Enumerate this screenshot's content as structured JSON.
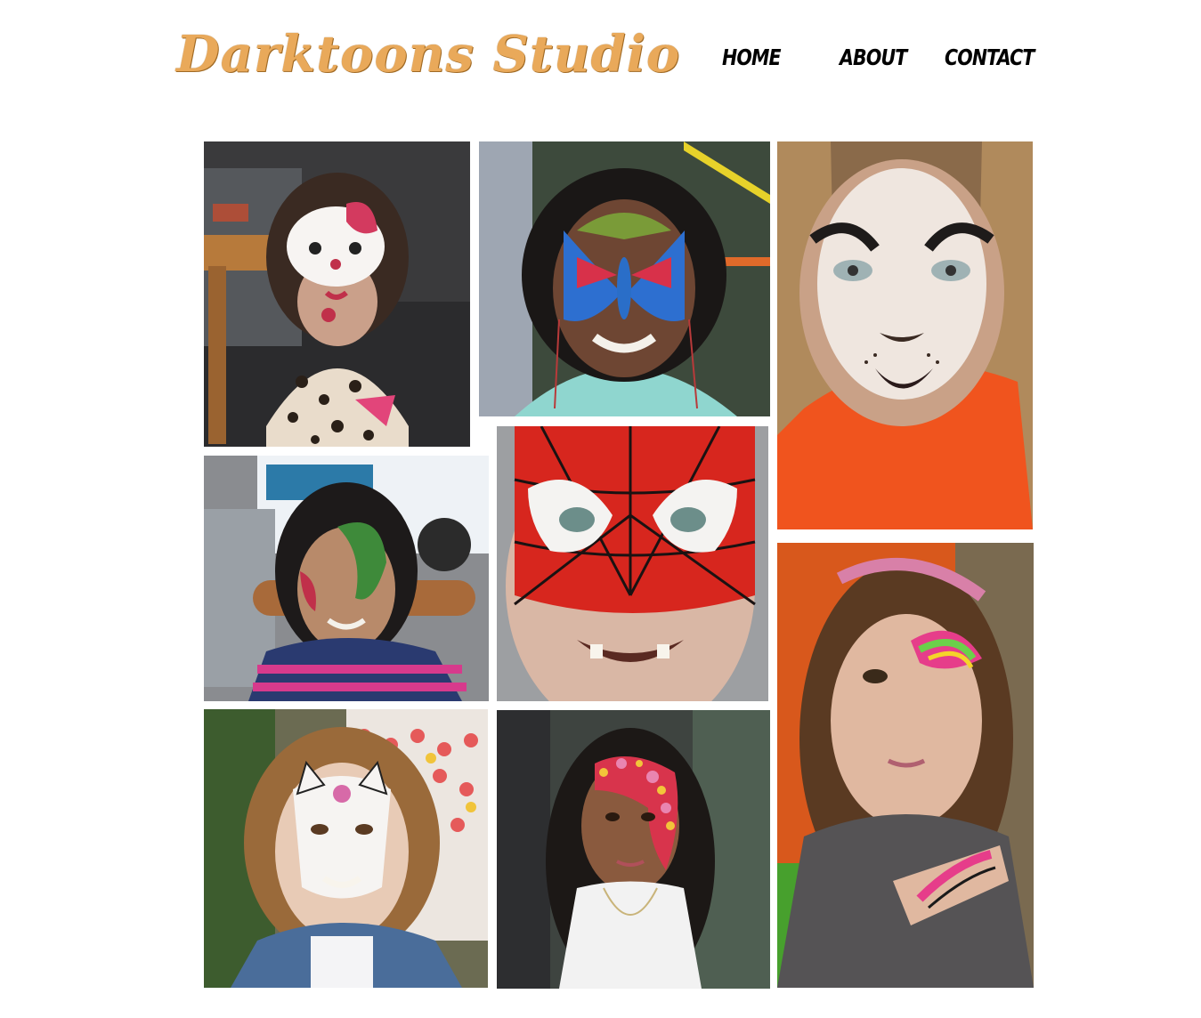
{
  "header": {
    "logo_text": "Darktoons Studio",
    "nav": [
      {
        "label": "HOME"
      },
      {
        "label": "ABOUT"
      },
      {
        "label": "CONTACT"
      }
    ]
  },
  "gallery": {
    "photos": [
      {
        "name": "kitty-face-paint-photo"
      },
      {
        "name": "butterfly-face-paint-photo"
      },
      {
        "name": "lion-face-paint-photo"
      },
      {
        "name": "dragon-face-paint-photo"
      },
      {
        "name": "spiderman-face-paint-photo"
      },
      {
        "name": "rainbow-eye-face-paint-photo"
      },
      {
        "name": "cat-face-paint-photo"
      },
      {
        "name": "flower-face-paint-photo"
      }
    ]
  },
  "colors": {
    "logo": "#e9a95a",
    "nav_text": "#000000",
    "background": "#ffffff"
  }
}
